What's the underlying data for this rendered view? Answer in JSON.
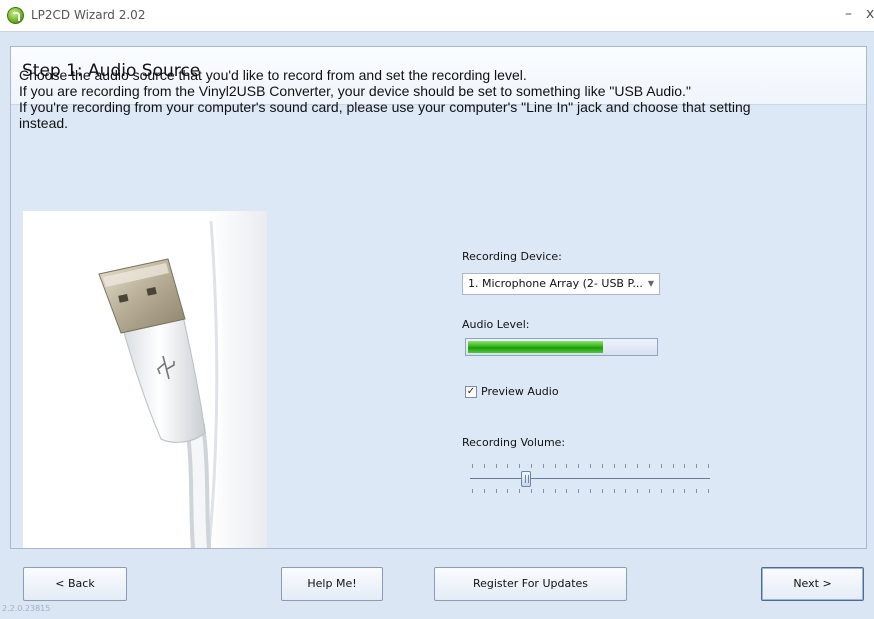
{
  "window": {
    "title": "LP2CD Wizard 2.02",
    "minimize_glyph": "–",
    "close_glyph": "x"
  },
  "step": {
    "title": "Step 1: Audio Source",
    "instructions": [
      "Choose the audio source that you'd like to record from and set the recording level.",
      "If you are recording from the Vinyl2USB Converter, your device should be set to something like \"USB Audio.\"",
      "If you're recording from your computer's sound card, please use your computer's \"Line In\" jack and choose that setting",
      "instead."
    ]
  },
  "controls": {
    "recording_device_label": "Recording Device:",
    "recording_device_value": "1. Microphone Array (2- USB P...",
    "audio_level_label": "Audio Level:",
    "audio_level_fraction": 0.72,
    "preview_audio_label": "Preview Audio",
    "preview_audio_checked": true,
    "recording_volume_label": "Recording Volume:",
    "recording_volume_position": 0.23
  },
  "buttons": {
    "back": "< Back",
    "help": "Help Me!",
    "register": "Register For Updates",
    "next": "Next >"
  },
  "version": "2.2.0.23815",
  "icons": {
    "app": "lp2cd-app-icon",
    "checkbox": "checkmark-icon",
    "dropdown": "chevron-down-icon"
  },
  "colors": {
    "panel_bg": "#dde8f6",
    "level_green": "#35b51c"
  }
}
